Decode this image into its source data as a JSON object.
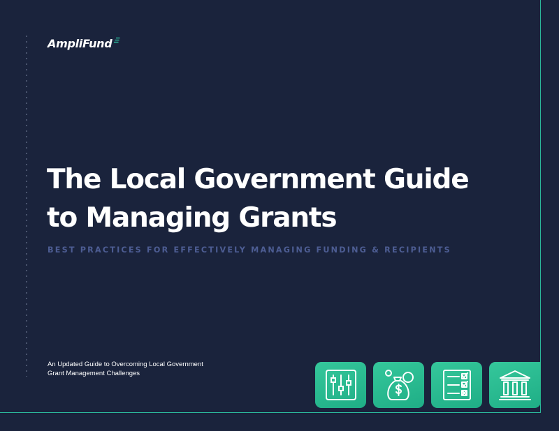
{
  "logo": {
    "text": "AmpliFund"
  },
  "title": {
    "line1": "The Local Government Guide",
    "line2": "to Managing Grants"
  },
  "subtitle": "BEST PRACTICES FOR EFFECTIVELY MANAGING FUNDING & RECIPIENTS",
  "tagline": {
    "line1": "An Updated Guide to Overcoming Local Government",
    "line2": "Grant Management Challenges"
  },
  "tiles": [
    {
      "icon": "sliders-icon"
    },
    {
      "icon": "money-bag-icon"
    },
    {
      "icon": "checklist-icon"
    },
    {
      "icon": "bank-building-icon"
    }
  ],
  "colors": {
    "background": "#1a233c",
    "accent": "#2bb79a",
    "tile": "#2ebd92",
    "subtitle": "#4d5d93",
    "text": "#ffffff"
  }
}
